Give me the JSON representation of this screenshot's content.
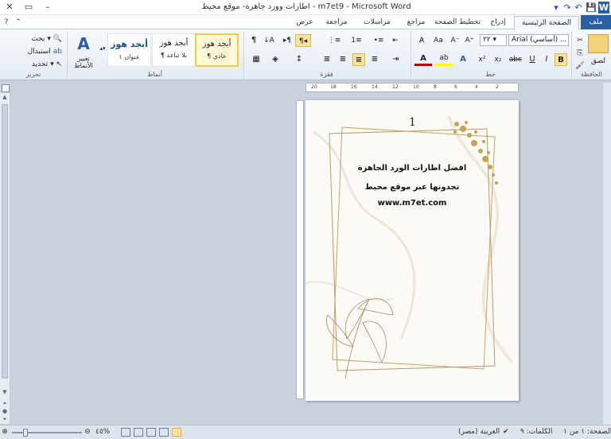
{
  "window": {
    "title": "اطارات وورد جاهزة- موقع محيط - m7et9 - Microsoft Word",
    "minimize": "–",
    "maximize": "▭",
    "close": "✕",
    "help": "?",
    "ribbon_toggle": "⌃"
  },
  "qat": {
    "app_icon": "W",
    "save": "💾",
    "undo": "↶",
    "redo": "↷",
    "more": "▾"
  },
  "tabs": {
    "file": "ملف",
    "home": "الصفحة الرئيسية",
    "insert": "إدراج",
    "page_layout": "تخطيط الصفحة",
    "references": "مراجع",
    "mailings": "مراسلات",
    "review": "مراجعة",
    "view": "عرض"
  },
  "clipboard": {
    "paste": "لصق",
    "label": "الحافظة",
    "cut": "✂",
    "copy": "⎘",
    "format_painter": "🖌"
  },
  "font": {
    "name": "Arial (أساسي) ...",
    "size": "٢٢",
    "label": "خط",
    "grow": "A⁺",
    "shrink": "A⁻",
    "change_case": "Aa",
    "clear": "A̷",
    "bold": "B",
    "italic": "I",
    "underline": "U",
    "strike": "abc",
    "subscript": "x₂",
    "superscript": "x²",
    "text_effects": "A",
    "highlight": "ab",
    "font_color": "A",
    "colors": {
      "highlight": "#ffff00",
      "font_color": "#c00000",
      "effects": "#2a5fa8"
    }
  },
  "paragraph": {
    "label": "فقرة",
    "rtl": "¶◂",
    "ltr": "▸¶",
    "sort": "↓A",
    "show_marks": "¶",
    "bullets": "•≡",
    "numbering": "1≡",
    "multilevel": "⋮≡",
    "indent_dec": "⇤",
    "indent_inc": "⇥",
    "align_right": "≡",
    "align_center": "≡",
    "align_left": "≡",
    "justify": "≡",
    "line_spacing": "↕",
    "shading": "◈",
    "borders": "▦"
  },
  "styles": {
    "label": "أنماط",
    "items": [
      {
        "sample": "أبجد هوز",
        "name": "¶ عادي"
      },
      {
        "sample": "أبجد هوز",
        "name": "¶ بلا تباعد"
      },
      {
        "sample": "أبجد هوز",
        "name": "عنوان ١"
      }
    ],
    "change_styles": "تغيير الأنماط",
    "change_icon": "A"
  },
  "editing": {
    "label": "تحرير",
    "find": "بحث",
    "replace": "استبدال",
    "select": "تحديد"
  },
  "ruler": {
    "ticks": [
      "20",
      "18",
      "16",
      "14",
      "12",
      "10",
      "8",
      "6",
      "4",
      "2"
    ]
  },
  "document": {
    "page_number": "1",
    "line1": "افضل اطارات الورد الجاهزة",
    "line2": "تجدونها عبر موقع محيط",
    "line3": "www.m7et.com"
  },
  "status": {
    "page": "الصفحة: ١ من ١",
    "words": "الكلمات: ٩",
    "language": "العربية (مصر)",
    "zoom": "٤٥%",
    "zoom_level": 0.45
  }
}
